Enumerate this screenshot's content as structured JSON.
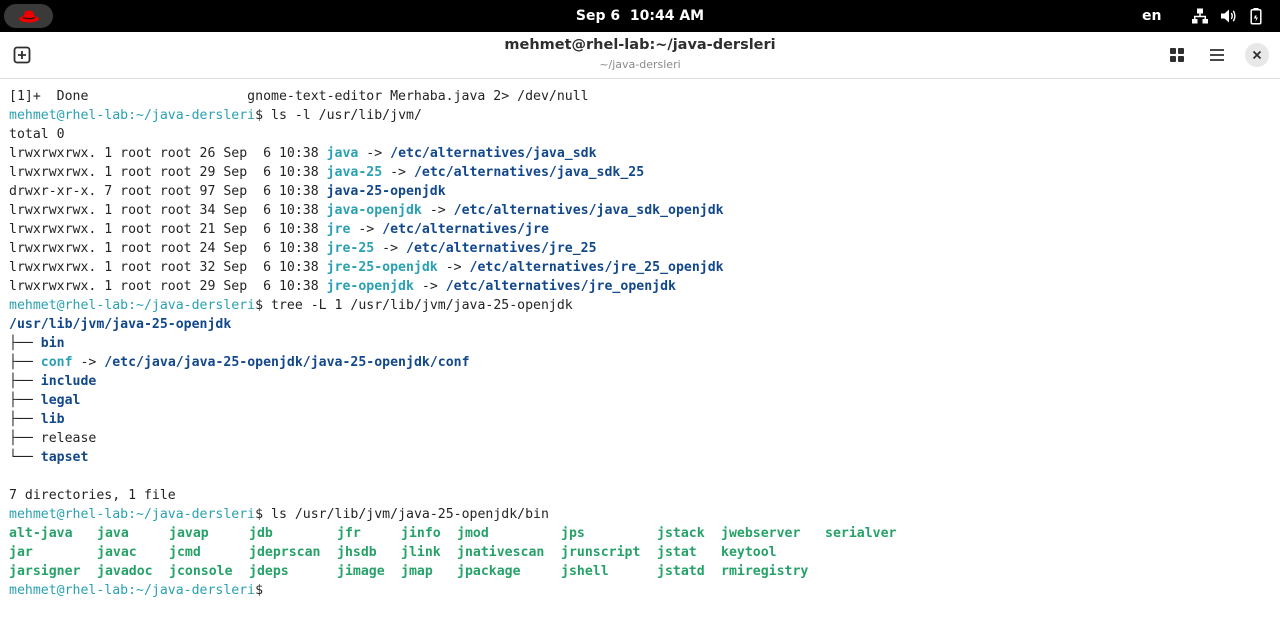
{
  "topbar": {
    "date": "Sep 6",
    "time": "10:44 AM",
    "lang": "en"
  },
  "window": {
    "title": "mehmet@rhel-lab:~/java-dersleri",
    "subtitle": "~/java-dersleri"
  },
  "prompt": {
    "user": "mehmet@rhel-lab",
    "path": ":~/java-dersleri",
    "dollar": "$"
  },
  "term": {
    "job_line": "[1]+  Done                    gnome-text-editor Merhaba.java 2> /dev/null",
    "cmd1": " ls -l /usr/lib/jvm/",
    "total": "total 0",
    "ls_rows": [
      {
        "meta": "lrwxrwxrwx. 1 root root 26 Sep  6 10:38 ",
        "name": "java",
        "arrow": " -> ",
        "target": "/etc/alternatives/java_sdk"
      },
      {
        "meta": "lrwxrwxrwx. 1 root root 29 Sep  6 10:38 ",
        "name": "java-25",
        "arrow": " -> ",
        "target": "/etc/alternatives/java_sdk_25"
      },
      {
        "meta": "drwxr-xr-x. 7 root root 97 Sep  6 10:38 ",
        "name": "java-25-openjdk"
      },
      {
        "meta": "lrwxrwxrwx. 1 root root 34 Sep  6 10:38 ",
        "name": "java-openjdk",
        "arrow": " -> ",
        "target": "/etc/alternatives/java_sdk_openjdk"
      },
      {
        "meta": "lrwxrwxrwx. 1 root root 21 Sep  6 10:38 ",
        "name": "jre",
        "arrow": " -> ",
        "target": "/etc/alternatives/jre"
      },
      {
        "meta": "lrwxrwxrwx. 1 root root 24 Sep  6 10:38 ",
        "name": "jre-25",
        "arrow": " -> ",
        "target": "/etc/alternatives/jre_25"
      },
      {
        "meta": "lrwxrwxrwx. 1 root root 32 Sep  6 10:38 ",
        "name": "jre-25-openjdk",
        "arrow": " -> ",
        "target": "/etc/alternatives/jre_25_openjdk"
      },
      {
        "meta": "lrwxrwxrwx. 1 root root 29 Sep  6 10:38 ",
        "name": "jre-openjdk",
        "arrow": " -> ",
        "target": "/etc/alternatives/jre_openjdk"
      }
    ],
    "cmd2": " tree -L 1 /usr/lib/jvm/java-25-openjdk",
    "tree_root": "/usr/lib/jvm/java-25-openjdk",
    "tree_branch": "├── ",
    "tree_last": "└── ",
    "tree_arrow": " -> ",
    "tree": {
      "bin": "bin",
      "conf": "conf",
      "conf_target": "/etc/java/java-25-openjdk/java-25-openjdk/conf",
      "include": "include",
      "legal": "legal",
      "lib": "lib",
      "release": "release",
      "tapset": "tapset"
    },
    "summary": "7 directories, 1 file",
    "cmd3": " ls /usr/lib/jvm/java-25-openjdk/bin",
    "bin_columns": [
      [
        "alt-java",
        "jar",
        "jarsigner"
      ],
      [
        "java",
        "javac",
        "javadoc"
      ],
      [
        "javap",
        "jcmd",
        "jconsole"
      ],
      [
        "jdb",
        "jdeprscan",
        "jdeps"
      ],
      [
        "jfr",
        "jhsdb",
        "jimage"
      ],
      [
        "jinfo",
        "jlink",
        "jmap"
      ],
      [
        "jmod",
        "jnativescan",
        "jpackage"
      ],
      [
        "jps",
        "jrunscript",
        "jshell"
      ],
      [
        "jstack",
        "jstat",
        "jstatd"
      ],
      [
        "jwebserver",
        "keytool",
        "rmiregistry"
      ],
      [
        "serialver"
      ]
    ]
  }
}
